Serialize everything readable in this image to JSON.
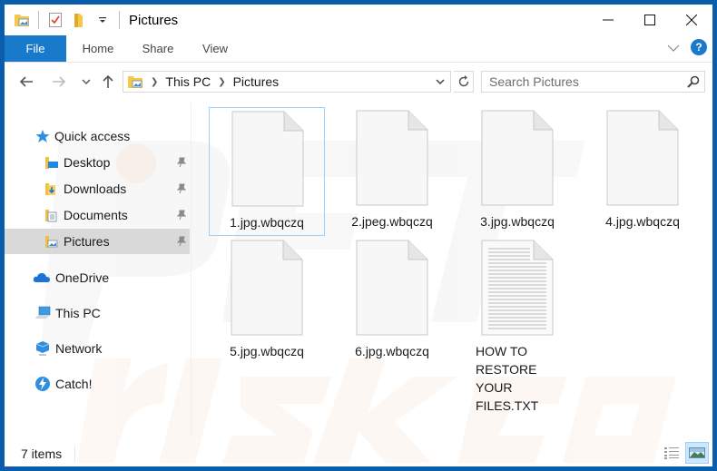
{
  "window": {
    "title": "Pictures",
    "controls": {
      "minimize": "minimize",
      "maximize": "maximize",
      "close": "close"
    }
  },
  "quick_access_toolbar": {
    "icons": [
      "pictures-folder-icon",
      "properties-icon",
      "new-folder-icon",
      "customize-dropdown-icon"
    ]
  },
  "ribbon": {
    "tabs": [
      {
        "label": "File",
        "active": true
      },
      {
        "label": "Home"
      },
      {
        "label": "Share"
      },
      {
        "label": "View"
      }
    ],
    "expand_icon": "chevron-down-icon",
    "help_label": "?"
  },
  "navigation": {
    "back": "back-arrow-icon",
    "forward": "forward-arrow-icon",
    "recent": "recent-locations-icon",
    "up": "up-arrow-icon",
    "breadcrumb": [
      "This PC",
      "Pictures"
    ],
    "search_placeholder": "Search Pictures"
  },
  "sidebar": {
    "items": [
      {
        "label": "Quick access",
        "icon": "star-icon",
        "level": 0
      },
      {
        "label": "Desktop",
        "icon": "desktop-folder-icon",
        "level": 1,
        "pinned": true
      },
      {
        "label": "Downloads",
        "icon": "downloads-folder-icon",
        "level": 1,
        "pinned": true
      },
      {
        "label": "Documents",
        "icon": "documents-folder-icon",
        "level": 1,
        "pinned": true
      },
      {
        "label": "Pictures",
        "icon": "pictures-folder-icon",
        "level": 1,
        "pinned": true,
        "selected": true
      },
      {
        "label": "OneDrive",
        "icon": "cloud-icon",
        "level": 0
      },
      {
        "label": "This PC",
        "icon": "computer-icon",
        "level": 0
      },
      {
        "label": "Network",
        "icon": "network-icon",
        "level": 0
      },
      {
        "label": "Catch!",
        "icon": "catch-icon",
        "level": 0
      }
    ]
  },
  "files": [
    {
      "name": "1.jpg.wbqczq",
      "type": "blank",
      "focused": true
    },
    {
      "name": "2.jpeg.wbqczq",
      "type": "blank"
    },
    {
      "name": "3.jpg.wbqczq",
      "type": "blank"
    },
    {
      "name": "4.jpg.wbqczq",
      "type": "blank"
    },
    {
      "name": "5.jpg.wbqczq",
      "type": "blank"
    },
    {
      "name": "6.jpg.wbqczq",
      "type": "blank"
    },
    {
      "name": "HOW TO RESTORE YOUR FILES.TXT",
      "type": "text"
    }
  ],
  "status": {
    "item_count": "7 items",
    "views": [
      "details-view",
      "large-icons-view"
    ],
    "active_view": "large-icons-view"
  },
  "colors": {
    "frame": "#0a5cad",
    "accent": "#1979ca",
    "selection": "#cce8ff",
    "selection_border": "#99d1ff",
    "sidebar_selected": "#d9d9d9"
  }
}
